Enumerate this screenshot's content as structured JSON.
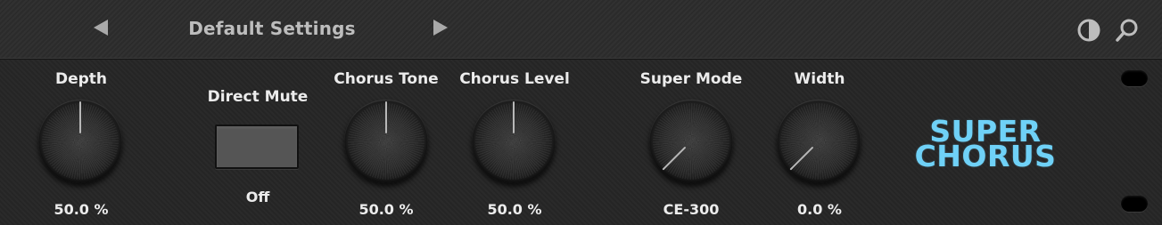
{
  "header": {
    "preset_name": "Default Settings"
  },
  "controls": {
    "depth": {
      "label": "Depth",
      "value": "50.0 %",
      "level": 0.5
    },
    "direct_mute": {
      "label": "Direct Mute",
      "value": "Off"
    },
    "chorus_tone": {
      "label": "Chorus Tone",
      "value": "50.0 %",
      "level": 0.5
    },
    "chorus_level": {
      "label": "Chorus Level",
      "value": "50.0 %",
      "level": 0.5
    },
    "super_mode": {
      "label": "Super Mode",
      "value": "CE-300",
      "level": 0.0
    },
    "width": {
      "label": "Width",
      "value": "0.0 %",
      "level": 0.0
    }
  },
  "logo": {
    "line1": "SUPER",
    "line2": "CHORUS"
  },
  "colors": {
    "accent": "#6fd1f7",
    "background": "#262626",
    "header": "#2c2c2c"
  },
  "icons": {
    "prev": "triangle-left-icon",
    "next": "triangle-right-icon",
    "contrast": "contrast-icon",
    "search": "search-icon"
  }
}
